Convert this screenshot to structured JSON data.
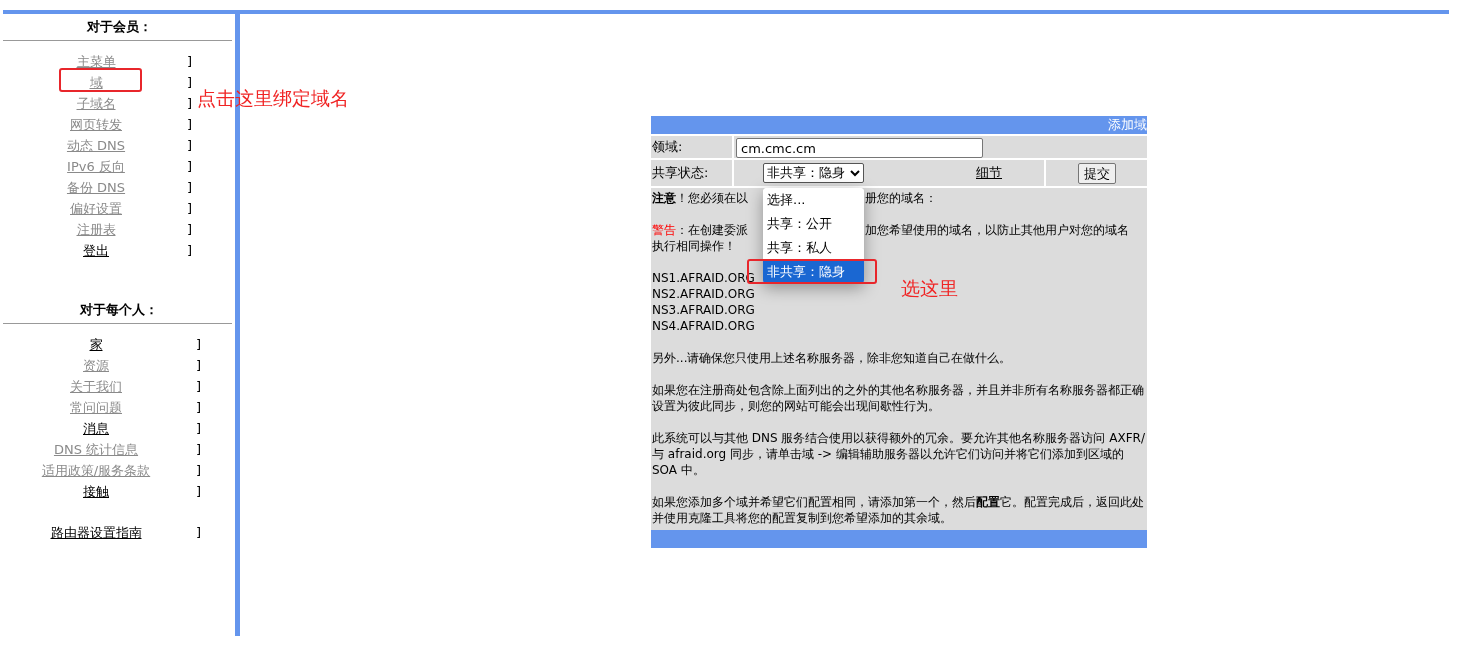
{
  "sidebar": {
    "sections": [
      {
        "title": "对于会员：",
        "items": [
          {
            "label": "主菜单",
            "visited": true,
            "bracket": "]"
          },
          {
            "label": "域",
            "visited": true,
            "bracket": "]"
          },
          {
            "label": "子域名",
            "visited": true,
            "bracket": "]"
          },
          {
            "label": "网页转发",
            "visited": true,
            "bracket": "]"
          },
          {
            "label": "动态 DNS",
            "visited": true,
            "bracket": "]"
          },
          {
            "label": "IPv6 反向",
            "visited": true,
            "bracket": "]"
          },
          {
            "label": "备份 DNS",
            "visited": true,
            "bracket": "]"
          },
          {
            "label": "偏好设置",
            "visited": true,
            "bracket": "]"
          },
          {
            "label": "注册表",
            "visited": true,
            "bracket": "]"
          },
          {
            "label": "登出",
            "visited": false,
            "bracket": "]"
          }
        ]
      },
      {
        "title": "对于每个人：",
        "items": [
          {
            "label": "家",
            "visited": false,
            "bracket": "]"
          },
          {
            "label": "资源",
            "visited": true,
            "bracket": "]"
          },
          {
            "label": "关于我们",
            "visited": true,
            "bracket": "]"
          },
          {
            "label": "常问问题",
            "visited": true,
            "bracket": "]"
          },
          {
            "label": "消息",
            "visited": false,
            "bracket": "]"
          },
          {
            "label": "DNS 统计信息",
            "visited": true,
            "bracket": "]"
          },
          {
            "label": "适用政策/服务条款",
            "visited": true,
            "bracket": "]"
          },
          {
            "label": "接触",
            "visited": false,
            "bracket": "]"
          }
        ],
        "extra": {
          "label": "路由器设置指南",
          "visited": false,
          "bracket": "]"
        }
      }
    ]
  },
  "form": {
    "title": "添加域",
    "domain": {
      "label": "领域:",
      "value": "cm.cmc.cm"
    },
    "share": {
      "label": "共享状态:",
      "value": "非共享：隐身",
      "details": "细节",
      "submit": "提交",
      "options": [
        {
          "label": "选择...",
          "selected": false
        },
        {
          "label": "共享：公开",
          "selected": false
        },
        {
          "label": "共享：私人",
          "selected": false
        },
        {
          "label": "非共享：隐身",
          "selected": true
        }
      ]
    },
    "note": {
      "bold": "注意",
      "left": "！您必须在以",
      "right": "册您的域名："
    },
    "warning": {
      "red": "警告",
      "left": "：在创建委派",
      "right": "加您希望使用的域名，以防止其他用户对您的域名",
      "rest": "执行相同操作！"
    },
    "nameservers": [
      "NS1.AFRAID.ORG",
      "NS2.AFRAID.ORG",
      "NS3.AFRAID.ORG",
      "NS4.AFRAID.ORG"
    ],
    "paragraphs": [
      "另外...请确保您只使用上述名称服务器，除非您知道自己在做什么。",
      "如果您在注册商处包含除上面列出的之外的其他名称服务器，并且并非所有名称服务器都正确设置为彼此同步，则您的网站可能会出现间歇性行为。",
      "此系统可以与其他 DNS 服务结合使用以获得额外的冗余。要允许其他名称服务器访问 AXFR/与 afraid.org 同步，请单击域 -> 编辑辅助服务器以允许它们访问并将它们添加到区域的 SOA 中。",
      "如果您添加多个域并希望它们配置相同，请添加第一个，然后**配置**它。配置完成后，返回此处并使用克隆工具将您的配置复制到您希望添加的其余域。"
    ]
  },
  "annotations": [
    {
      "kind": "domain-hint",
      "text": "点击这里绑定域名"
    },
    {
      "kind": "option-hint",
      "text": "选这里"
    }
  ]
}
